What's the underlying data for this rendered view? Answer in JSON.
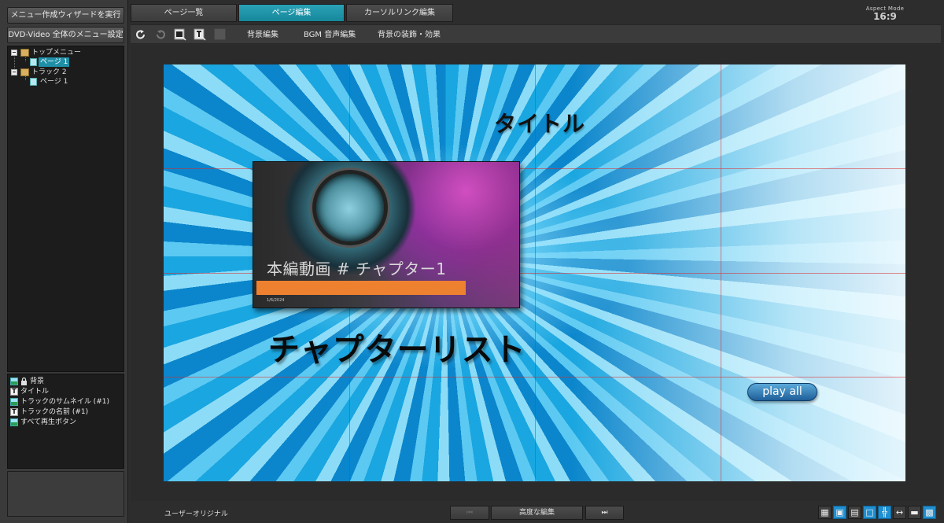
{
  "left_panel": {
    "wizard_button": "メニュー作成ウィザードを実行",
    "menu_settings_button": "DVD-Video 全体のメニュー設定",
    "tree": [
      {
        "label": "トップメニュー"
      },
      {
        "label": "ページ 1",
        "selected": true
      },
      {
        "label": "トラック 2"
      },
      {
        "label": "ページ 1"
      }
    ],
    "objects": [
      {
        "icon": "image-icon",
        "label": "背景",
        "locked": true
      },
      {
        "icon": "text-icon",
        "label": "タイトル"
      },
      {
        "icon": "image-icon",
        "label": "トラックのサムネイル (#1)"
      },
      {
        "icon": "text-icon",
        "label": "トラックの名前 (#1)"
      },
      {
        "icon": "image-icon",
        "label": "すべて再生ボタン"
      }
    ]
  },
  "tabs": [
    {
      "label": "ページ一覧",
      "active": false
    },
    {
      "label": "ページ編集",
      "active": true
    },
    {
      "label": "カーソルリンク編集",
      "active": false
    }
  ],
  "aspect": {
    "label": "Aspect Mode",
    "value": "16:9"
  },
  "toolbar": {
    "bg_edit": "背景編集",
    "bgm_edit": "BGM 音声編集",
    "bg_decor": "背景の装飾・効果",
    "text_icon_glyph": "T"
  },
  "canvas": {
    "title": "タイトル",
    "chapter_list": "チャプターリスト",
    "thumbnail_caption": "本編動画 # チャプター1",
    "thumbnail_date": "1/6/2024",
    "play_all": "play all"
  },
  "bottom": {
    "user_original": "ユーザーオリジナル",
    "prev_glyph": "⏮",
    "advanced_edit": "高度な編集",
    "next_glyph": "⏭"
  },
  "colors": {
    "accent": "#1f8fa8",
    "thumbnail_bar": "#ee8130",
    "grid_line": "#dc2828"
  }
}
